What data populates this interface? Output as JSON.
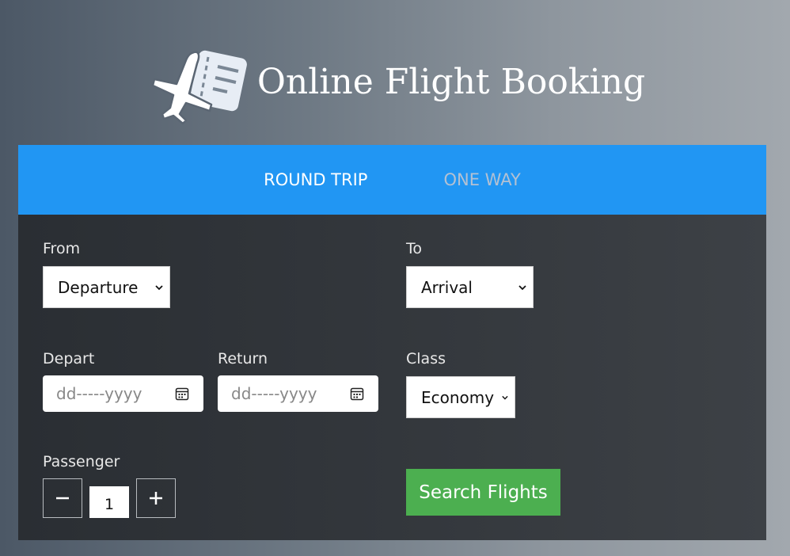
{
  "header": {
    "title": "Online Flight Booking",
    "logo_icon": "plane-ticket-icon"
  },
  "tabs": [
    {
      "label": "ROUND TRIP",
      "active": true
    },
    {
      "label": "ONE WAY",
      "active": false
    }
  ],
  "form": {
    "from": {
      "label": "From",
      "value": "Departure"
    },
    "to": {
      "label": "To",
      "value": "Arrival"
    },
    "depart": {
      "label": "Depart",
      "placeholder": "dd-----yyyy"
    },
    "return": {
      "label": "Return",
      "placeholder": "dd-----yyyy"
    },
    "class": {
      "label": "Class",
      "value": "Economy"
    },
    "passenger": {
      "label": "Passenger",
      "value": "1"
    },
    "search_label": "Search Flights"
  },
  "colors": {
    "tab_bar": "#2196f3",
    "search_button": "#4caf50",
    "panel": "#33373c"
  }
}
